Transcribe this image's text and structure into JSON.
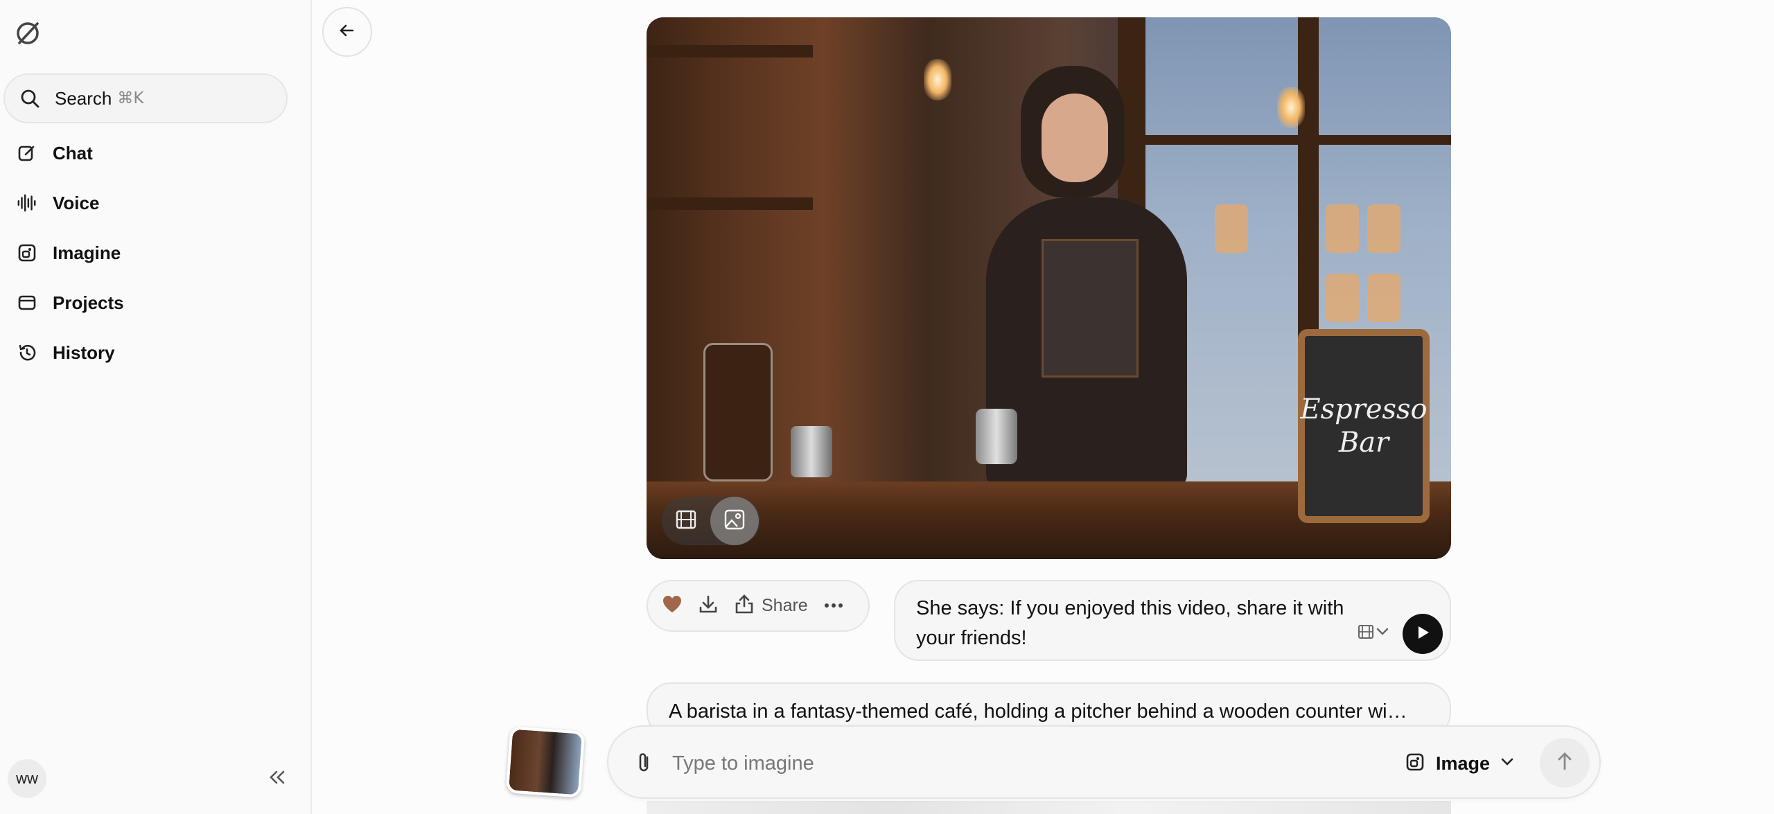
{
  "sidebar": {
    "logo_icon": "grok-logo-icon",
    "search": {
      "label": "Search",
      "shortcut": "⌘K"
    },
    "items": [
      {
        "label": "Chat",
        "icon": "edit-icon"
      },
      {
        "label": "Voice",
        "icon": "waveform-icon"
      },
      {
        "label": "Imagine",
        "icon": "imagine-icon"
      },
      {
        "label": "Projects",
        "icon": "folder-icon"
      },
      {
        "label": "History",
        "icon": "history-icon"
      }
    ],
    "user_initials": "ww"
  },
  "image": {
    "sign_line1": "Espresso",
    "sign_line2": "Bar"
  },
  "actions": {
    "share_label": "Share"
  },
  "prompt": {
    "text": "She says: If you enjoyed this video, share it with your friends!"
  },
  "description": {
    "text": "A barista in a fantasy-themed café, holding a pitcher behind a wooden counter wi…"
  },
  "composer": {
    "placeholder": "Type to imagine",
    "mode_label": "Image"
  },
  "colors": {
    "accent_heart": "#a0674a",
    "play_button": "#111111"
  }
}
